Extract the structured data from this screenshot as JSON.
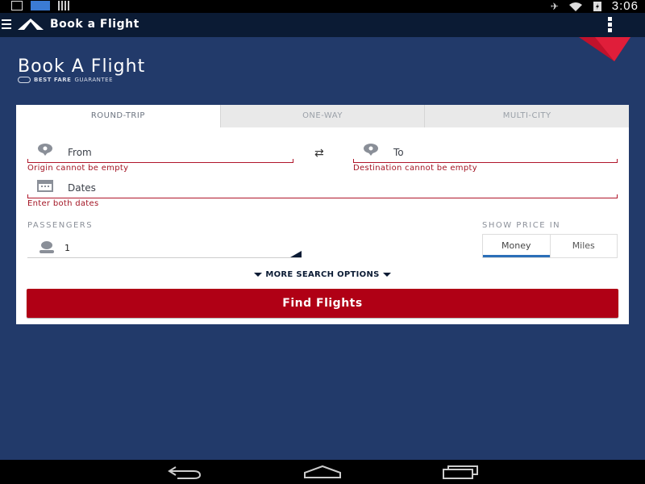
{
  "statusbar": {
    "time": "3:06"
  },
  "appbar": {
    "title": "Book a Flight"
  },
  "hero": {
    "title": "Book A Flight",
    "guarantee_bold": "BEST FARE",
    "guarantee_rest": "GUARANTEE"
  },
  "tabs": [
    {
      "label": "ROUND-TRIP",
      "active": true
    },
    {
      "label": "ONE-WAY",
      "active": false
    },
    {
      "label": "MULTI-CITY",
      "active": false
    }
  ],
  "form": {
    "from_label": "From",
    "from_error": "Origin cannot be empty",
    "to_label": "To",
    "to_error": "Destination cannot be empty",
    "dates_label": "Dates",
    "dates_error": "Enter both dates",
    "passengers_label": "PASSENGERS",
    "passengers_value": "1",
    "price_label": "SHOW PRICE IN",
    "price_options": [
      "Money",
      "Miles"
    ],
    "price_selected": "Money",
    "more_options": "MORE SEARCH OPTIONS",
    "submit": "Find Flights"
  },
  "colors": {
    "brand_red": "#b00015",
    "navy": "#0b1b34",
    "background": "#223a6a",
    "accent_blue": "#2b6fb8"
  },
  "icons": [
    "download-icon",
    "photo-icon",
    "barcode-icon",
    "mute-icon",
    "wifi-icon",
    "battery-icon",
    "menu-icon",
    "delta-logo-icon",
    "location-pin-icon",
    "calendar-icon",
    "swap-icon",
    "passenger-icon",
    "back-icon",
    "home-icon",
    "recent-apps-icon"
  ]
}
